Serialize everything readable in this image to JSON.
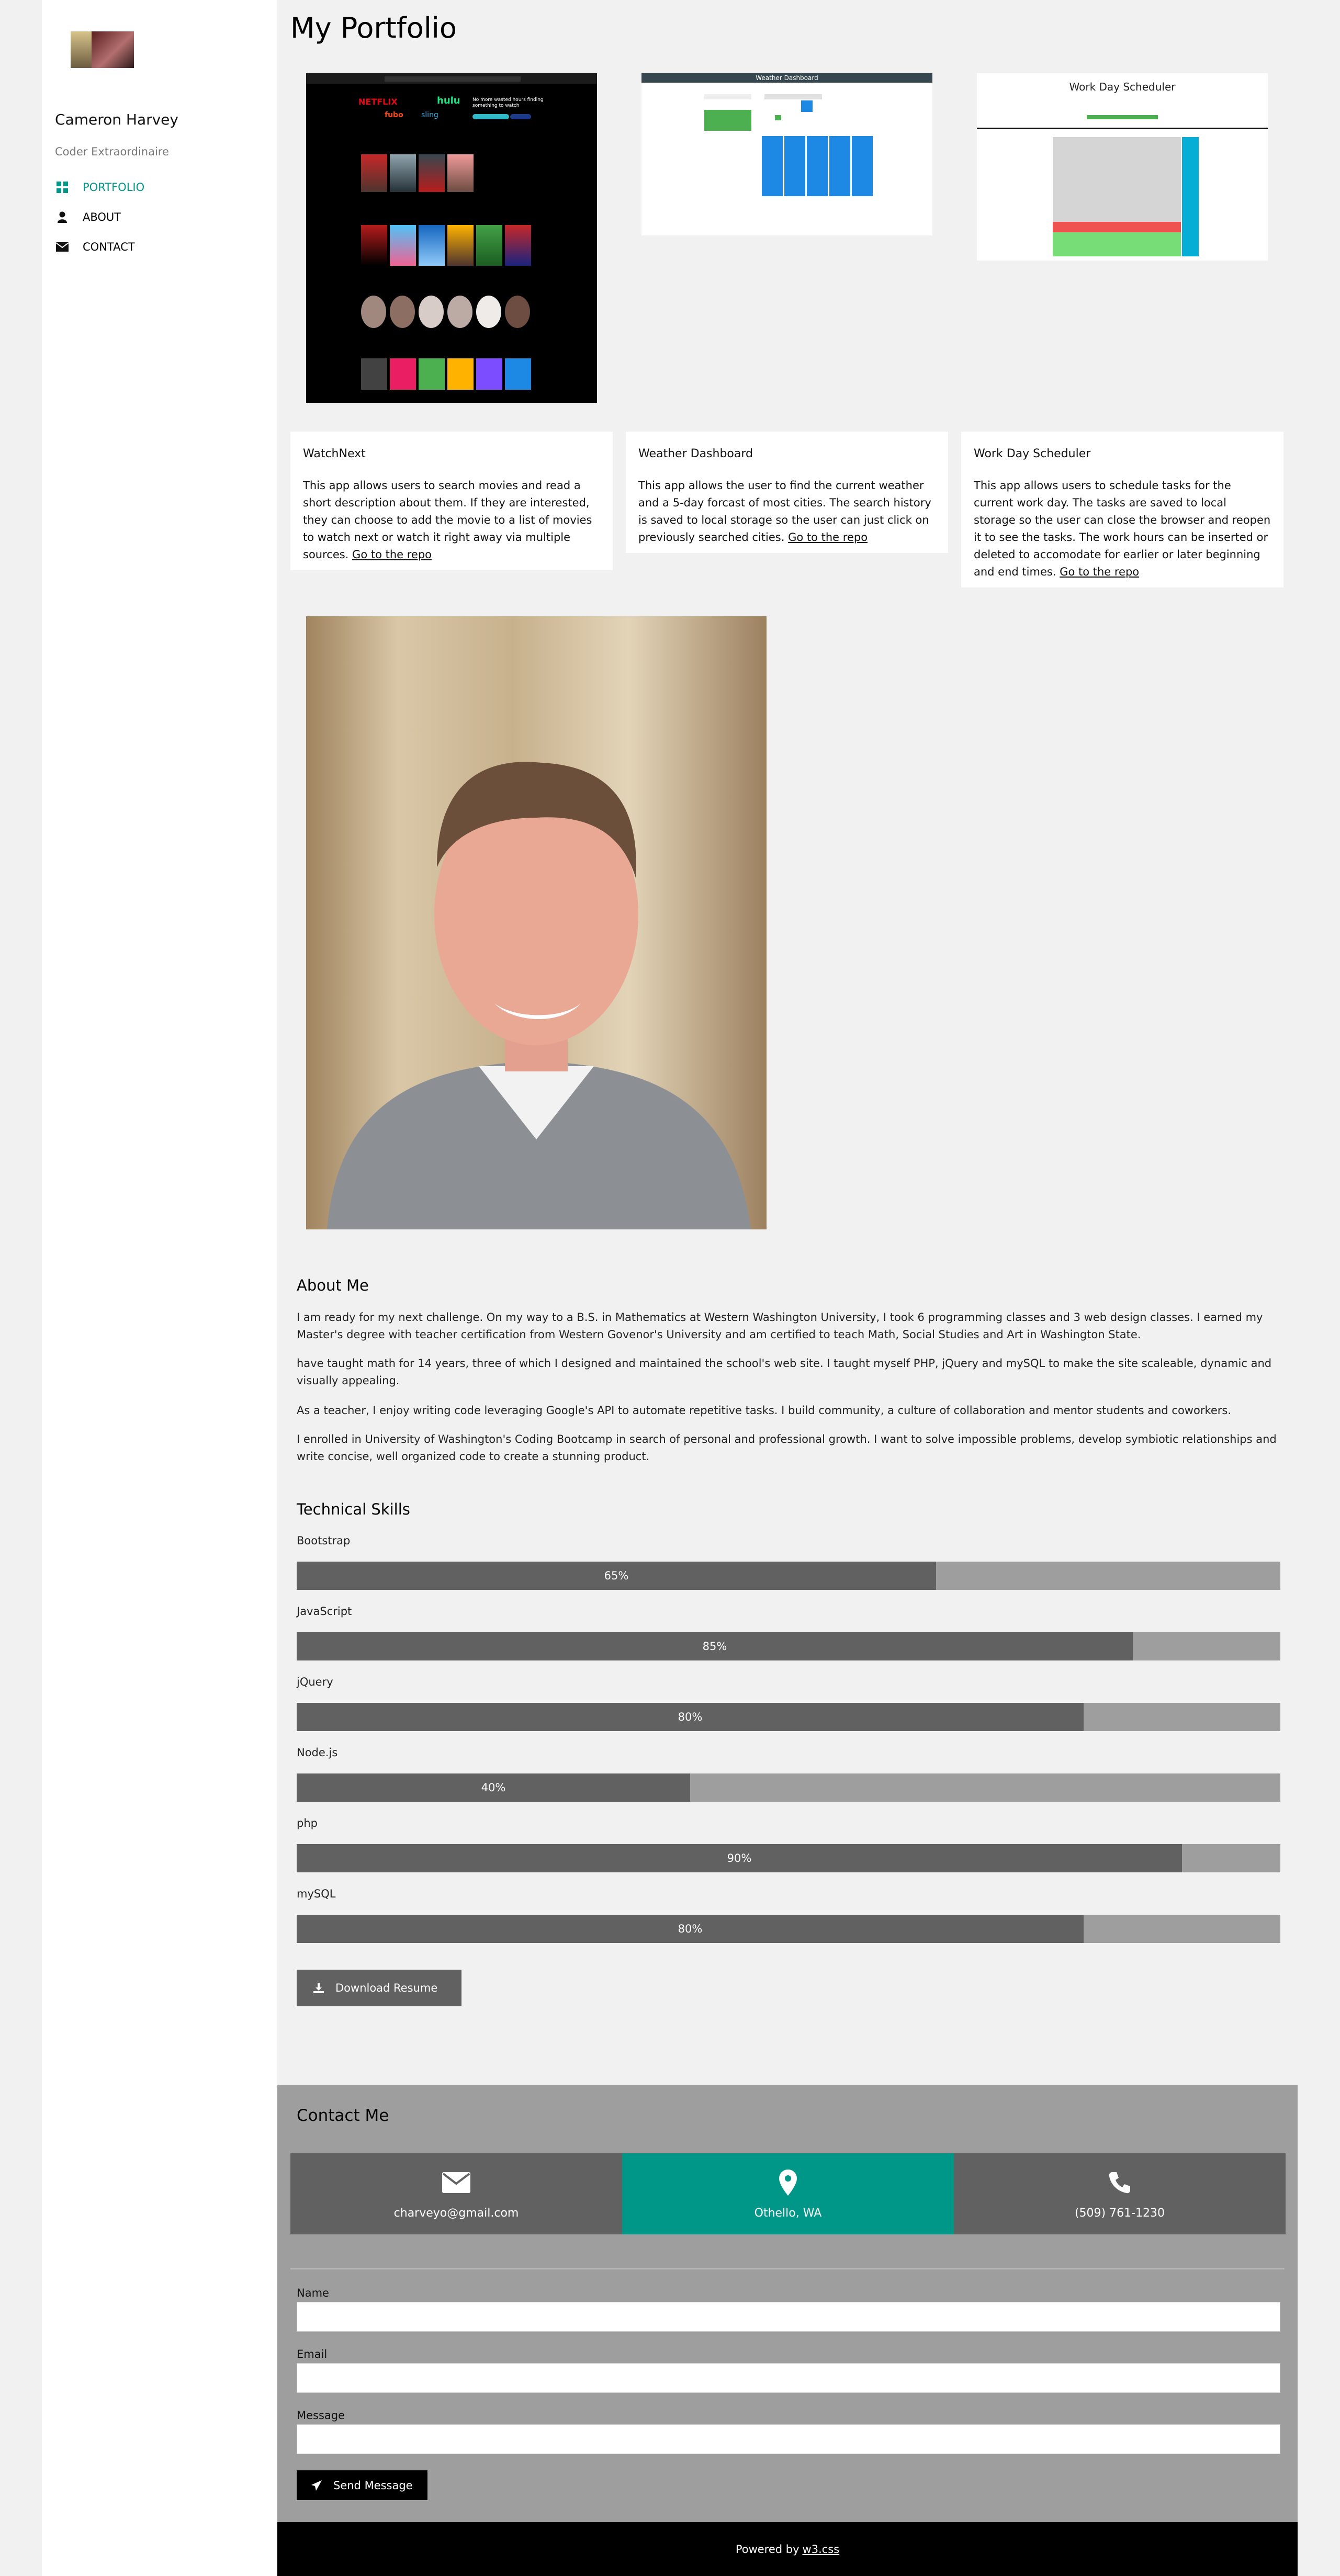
{
  "sidebar": {
    "name": "Cameron Harvey",
    "subtitle": "Coder Extraordinaire",
    "nav": [
      {
        "label": "PORTFOLIO",
        "icon": "grid-icon",
        "active": true
      },
      {
        "label": "ABOUT",
        "icon": "user-icon",
        "active": false
      },
      {
        "label": "CONTACT",
        "icon": "envelope-icon",
        "active": false
      }
    ]
  },
  "page_title": "My Portfolio",
  "projects": [
    {
      "title": "WatchNext",
      "description": "This app allows users to search movies and read a short description about them. If they are interested, they can choose to add the movie to a list of movies to watch next or watch it right away via multiple sources.",
      "link": "Go to the repo",
      "shot": {
        "brands": [
          "NETFLIX",
          "hulu",
          "fubo",
          "sling"
        ],
        "tagline": "No more wasted hours finding something to watch"
      }
    },
    {
      "title": "Weather Dashboard",
      "description": "This app allows the user to find the current weather and a 5-day forcast of most cities. The search history is saved to local storage so the user can just click on previously searched cities.",
      "link": "Go to the repo",
      "shot": {
        "header": "Weather Dashboard"
      }
    },
    {
      "title": "Work Day Scheduler",
      "description": "This app allows users to schedule tasks for the current work day. The tasks are saved to local storage so the user can close the browser and reopen it to see the tasks. The work hours can be inserted or deleted to accomodate for earlier or later beginning and end times.",
      "link": "Go to the repo",
      "shot": {
        "header": "Work Day Scheduler"
      }
    }
  ],
  "about": {
    "heading": "About Me",
    "paragraphs": [
      "I am ready for my next challenge. On my way to a B.S. in Mathematics at Western Washington University, I took 6 programming classes and 3 web design classes. I earned my Master's degree with teacher certification from Western Govenor's University and am certified to teach Math, Social Studies and Art in Washington State.",
      "have taught math for 14 years, three of which I designed and maintained the school's web site. I taught myself PHP, jQuery and mySQL to make the site scaleable, dynamic and visually appealing.",
      "As a teacher, I enjoy writing code leveraging Google's API to automate repetitive tasks. I build community, a culture of collaboration and mentor students and coworkers.",
      "I enrolled in University of Washington's Coding Bootcamp in search of personal and professional growth. I want to solve impossible problems, develop symbiotic relationships and write concise, well organized code to create a stunning product."
    ]
  },
  "skills": {
    "heading": "Technical Skills",
    "items": [
      {
        "name": "Bootstrap",
        "percent": 65,
        "label": "65%"
      },
      {
        "name": "JavaScript",
        "percent": 85,
        "label": "85%"
      },
      {
        "name": "jQuery",
        "percent": 80,
        "label": "80%"
      },
      {
        "name": "Node.js",
        "percent": 40,
        "label": "40%"
      },
      {
        "name": "php",
        "percent": 90,
        "label": "90%"
      },
      {
        "name": "mySQL",
        "percent": 80,
        "label": "80%"
      }
    ],
    "download_label": "Download Resume"
  },
  "contact": {
    "heading": "Contact Me",
    "email": "charveyo@gmail.com",
    "location": "Othello, WA",
    "phone": "(509) 761-1230",
    "name_label": "Name",
    "email_label": "Email",
    "message_label": "Message",
    "send_label": "Send Message"
  },
  "footer": {
    "text": "Powered by",
    "link": "w3.css"
  },
  "colors": {
    "accent": "#009688",
    "dark": "#616161",
    "mid": "#9e9e9e",
    "bg": "#f1f1f1"
  }
}
